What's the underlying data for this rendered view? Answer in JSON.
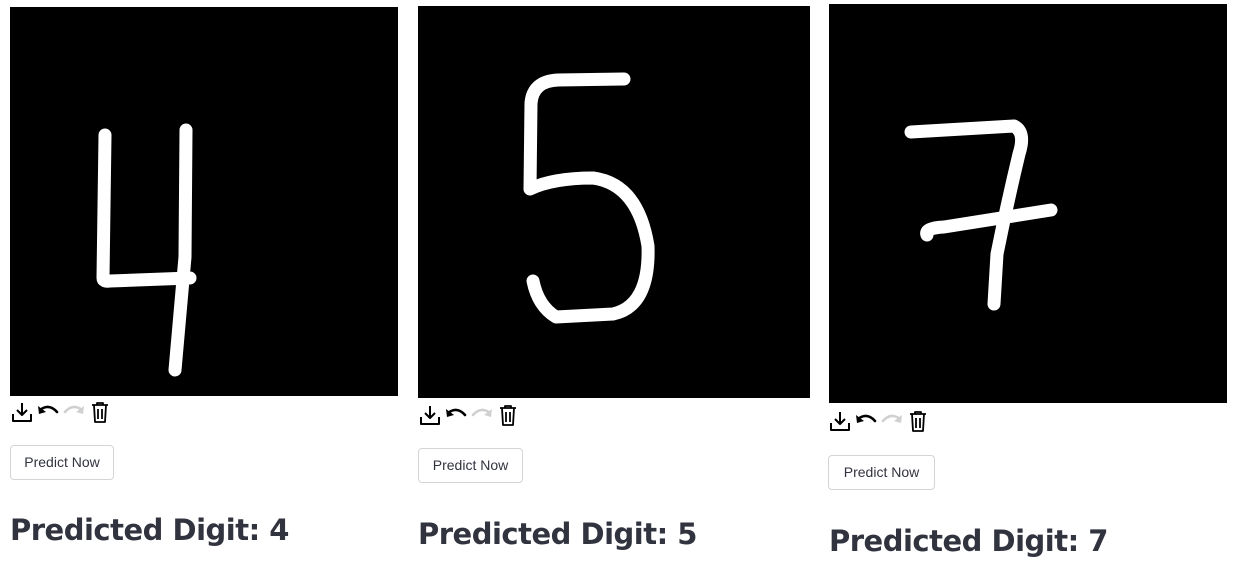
{
  "panels": [
    {
      "digit_drawn": "4",
      "toolbar": {
        "download_icon": "download-icon",
        "undo_icon": "undo-icon",
        "redo_icon": "redo-icon",
        "delete_icon": "trash-icon"
      },
      "predict_button_label": "Predict Now",
      "result_text": "Predicted Digit: 4"
    },
    {
      "digit_drawn": "5",
      "toolbar": {
        "download_icon": "download-icon",
        "undo_icon": "undo-icon",
        "redo_icon": "redo-icon",
        "delete_icon": "trash-icon"
      },
      "predict_button_label": "Predict Now",
      "result_text": "Predicted Digit: 5"
    },
    {
      "digit_drawn": "7",
      "toolbar": {
        "download_icon": "download-icon",
        "undo_icon": "undo-icon",
        "redo_icon": "redo-icon",
        "delete_icon": "trash-icon"
      },
      "predict_button_label": "Predict Now",
      "result_text": "Predicted Digit: 7"
    }
  ],
  "colors": {
    "canvas_background": "#000000",
    "stroke": "#ffffff",
    "text": "#31333f",
    "button_border": "#d3d4d8",
    "redo_disabled": "#d0d0d0"
  }
}
